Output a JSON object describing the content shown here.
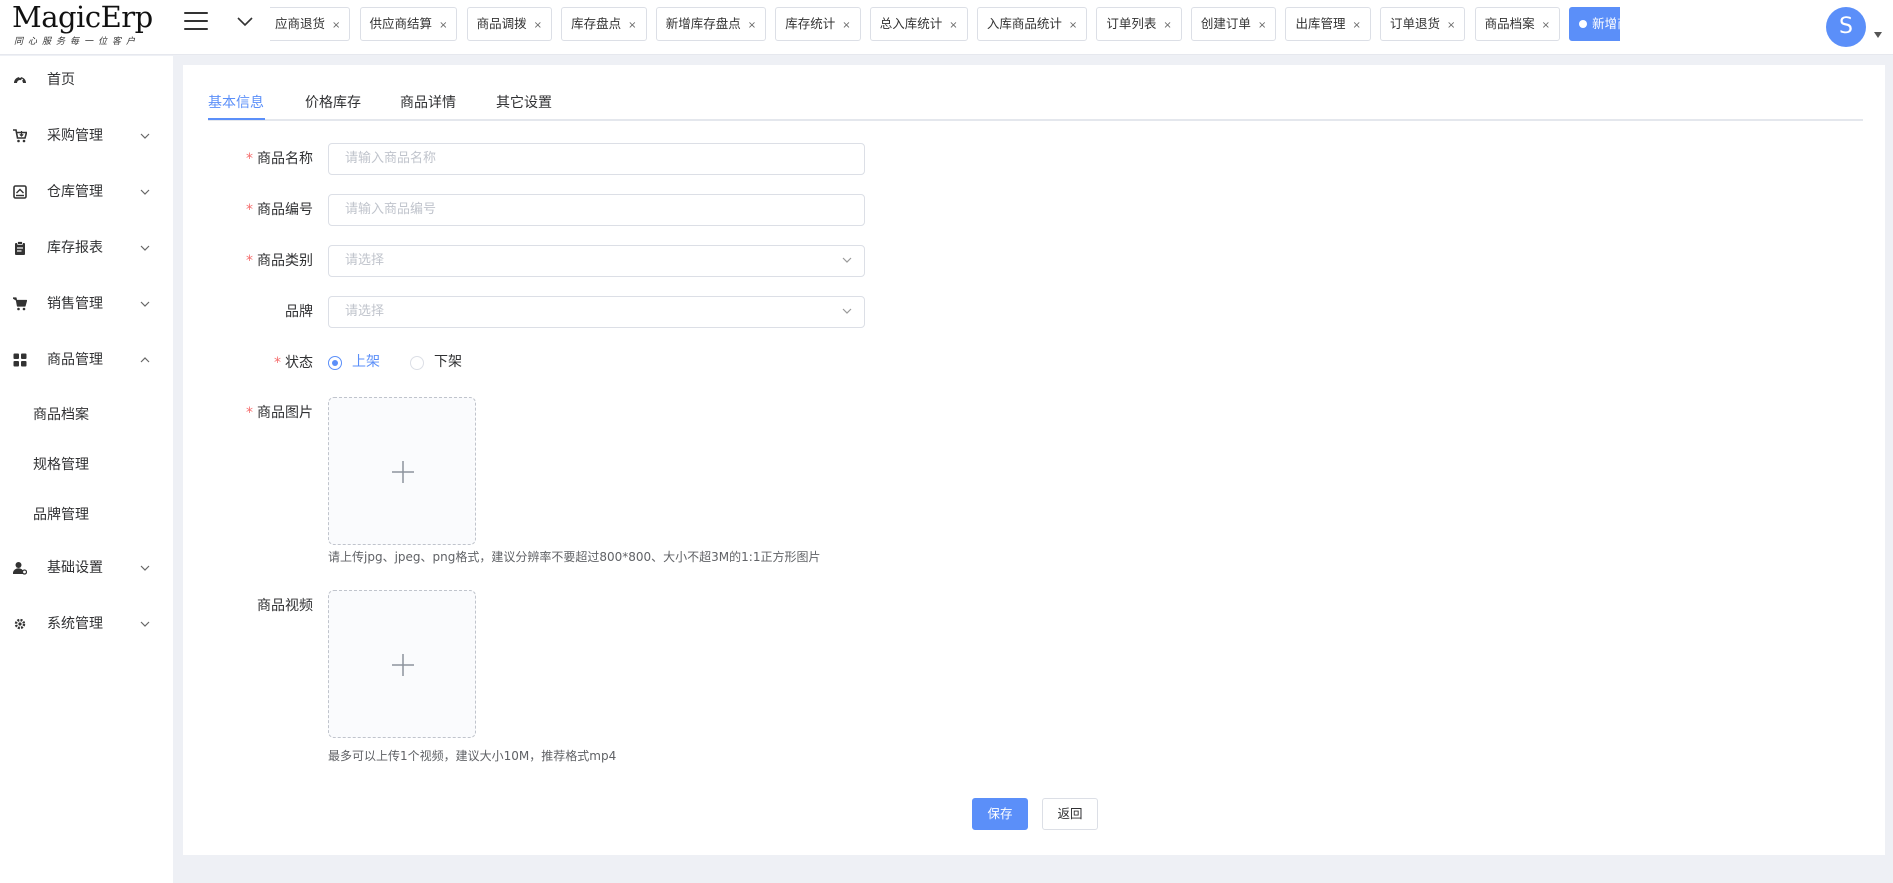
{
  "header": {
    "brand": "MagicErp",
    "slogan": "同心服务每一位客户",
    "avatar_letter": "S",
    "tags": [
      {
        "label": "应商退货"
      },
      {
        "label": "供应商结算"
      },
      {
        "label": "商品调拨"
      },
      {
        "label": "库存盘点"
      },
      {
        "label": "新增库存盘点"
      },
      {
        "label": "库存统计"
      },
      {
        "label": "总入库统计"
      },
      {
        "label": "入库商品统计"
      },
      {
        "label": "订单列表"
      },
      {
        "label": "创建订单"
      },
      {
        "label": "出库管理"
      },
      {
        "label": "订单退货"
      },
      {
        "label": "商品档案"
      },
      {
        "label": "新增商品"
      }
    ],
    "close_glyph": "×"
  },
  "sidebar": {
    "items": [
      {
        "label": "首页",
        "icon": "dashboard-icon"
      },
      {
        "label": "采购管理",
        "icon": "cart-in-icon"
      },
      {
        "label": "仓库管理",
        "icon": "warehouse-icon"
      },
      {
        "label": "库存报表",
        "icon": "clipboard-icon"
      },
      {
        "label": "销售管理",
        "icon": "cart-icon"
      },
      {
        "label": "商品管理",
        "icon": "grid-icon"
      },
      {
        "label": "基础设置",
        "icon": "user-settings-icon"
      },
      {
        "label": "系统管理",
        "icon": "gear-icon"
      }
    ],
    "sub_items": [
      {
        "label": "商品档案"
      },
      {
        "label": "规格管理"
      },
      {
        "label": "品牌管理"
      }
    ]
  },
  "tabs": [
    {
      "label": "基本信息"
    },
    {
      "label": "价格库存"
    },
    {
      "label": "商品详情"
    },
    {
      "label": "其它设置"
    }
  ],
  "form": {
    "name": {
      "label": "商品名称",
      "placeholder": "请输入商品名称"
    },
    "code": {
      "label": "商品编号",
      "placeholder": "请输入商品编号"
    },
    "category": {
      "label": "商品类别",
      "placeholder": "请选择"
    },
    "brand": {
      "label": "品牌",
      "placeholder": "请选择"
    },
    "status": {
      "label": "状态",
      "options": [
        "上架",
        "下架"
      ],
      "selected": "上架"
    },
    "image": {
      "label": "商品图片",
      "hint": "请上传jpg、jpeg、png格式，建议分辨率不要超过800*800、大小不超3M的1:1正方形图片"
    },
    "video": {
      "label": "商品视频",
      "hint": "最多可以上传1个视频，建议大小10M，推荐格式mp4"
    },
    "required_mark": "*"
  },
  "actions": {
    "save": "保存",
    "back": "返回"
  },
  "colors": {
    "primary": "#5b8ff9",
    "required": "#f56c6c",
    "background": "#eef0f5"
  }
}
